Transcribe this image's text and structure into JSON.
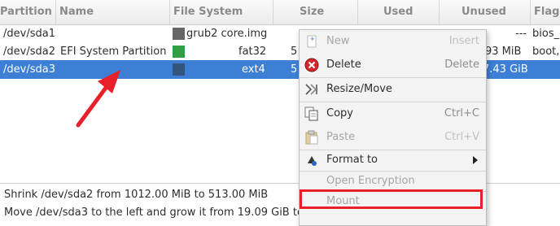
{
  "table": {
    "columns": [
      "Partition",
      "Name",
      "File System",
      "Size",
      "Used",
      "Unused",
      "Flags"
    ],
    "rows": [
      {
        "partition": "/dev/sda1",
        "name": "",
        "fs_label": "grub2 core.img",
        "fs_color": "#666666",
        "size": "",
        "used": "",
        "unused": "---",
        "flags": "bios_grub"
      },
      {
        "partition": "/dev/sda2",
        "name": "EFI System Partition",
        "fs_label": "fat32",
        "fs_color": "#2ea043",
        "size": "5",
        "used": "",
        "unused": "93 MiB",
        "flags": "boot, esp"
      },
      {
        "partition": "/dev/sda3",
        "name": "",
        "fs_label": "ext4",
        "fs_color": "#33557d",
        "size": "5",
        "used": "",
        "unused": "7.43 GiB",
        "flags": ""
      }
    ],
    "selected_row": 2
  },
  "operations_log": [
    "Shrink /dev/sda2 from 1012.00 MiB to 513.00 MiB",
    "Move /dev/sda3 to the left and grow it from 19.09 GiB to"
  ],
  "context_menu": {
    "items": [
      {
        "label": "New",
        "shortcut": "Insert",
        "icon": "new-icon",
        "enabled": false
      },
      {
        "label": "Delete",
        "shortcut": "Delete",
        "icon": "delete-icon",
        "enabled": true
      },
      {
        "label": "Resize/Move",
        "shortcut": "",
        "icon": "resize-move-icon",
        "enabled": true
      },
      {
        "label": "Copy",
        "shortcut": "Ctrl+C",
        "icon": "copy-icon",
        "enabled": true
      },
      {
        "label": "Paste",
        "shortcut": "Ctrl+V",
        "icon": "paste-icon",
        "enabled": false
      },
      {
        "label": "Format to",
        "shortcut": "",
        "icon": "format-icon",
        "enabled": true,
        "has_submenu": true
      },
      {
        "label": "Open Encryption",
        "shortcut": "",
        "icon": "",
        "enabled": false
      },
      {
        "label": "Mount",
        "shortcut": "",
        "icon": "",
        "enabled": false
      }
    ]
  },
  "colors": {
    "selection": "#3d7fd4",
    "annotation": "#e8202a"
  }
}
